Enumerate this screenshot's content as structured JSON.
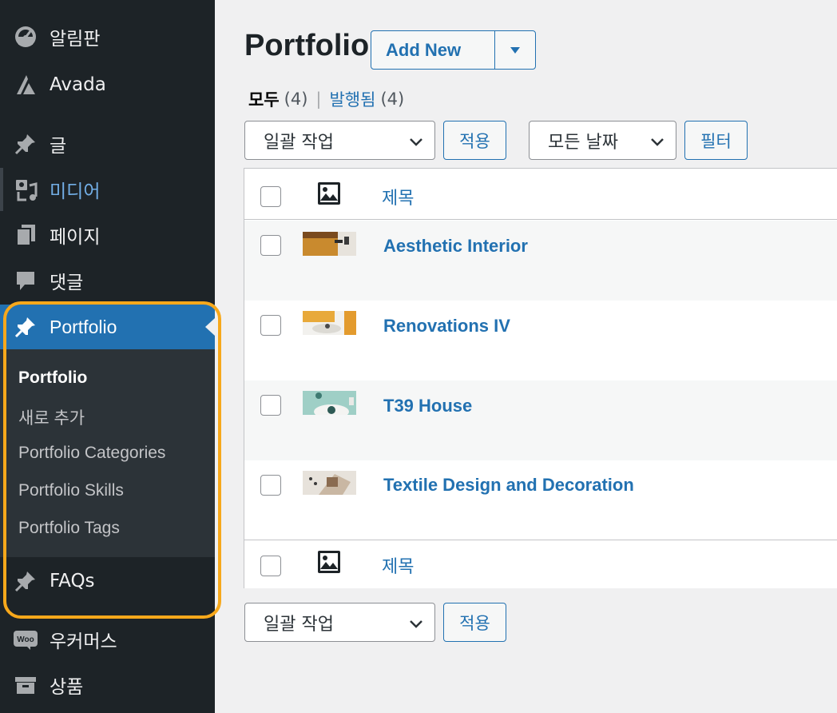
{
  "sidebar": {
    "items": [
      {
        "label": "알림판",
        "icon": "dashboard-icon"
      },
      {
        "label": "Avada",
        "icon": "avada-icon"
      },
      {
        "label": "글",
        "icon": "pin-icon"
      },
      {
        "label": "미디어",
        "icon": "media-icon"
      },
      {
        "label": "페이지",
        "icon": "pages-icon"
      },
      {
        "label": "댓글",
        "icon": "comments-icon"
      },
      {
        "label": "Portfolio",
        "icon": "pin-icon"
      },
      {
        "label": "FAQs",
        "icon": "pin-icon"
      },
      {
        "label": "우커머스",
        "icon": "woo-icon"
      },
      {
        "label": "상품",
        "icon": "archive-icon"
      }
    ],
    "submenu": [
      "Portfolio",
      "새로 추가",
      "Portfolio Categories",
      "Portfolio Skills",
      "Portfolio Tags"
    ],
    "woo_logo_text": "Woo"
  },
  "main": {
    "title": "Portfolio",
    "add_new": "Add New",
    "filters": {
      "all_label": "모두",
      "all_count": "(4)",
      "separator": "|",
      "published_label": "발행됨",
      "published_count": "(4)"
    },
    "bulk_action": "일괄 작업",
    "apply": "적용",
    "dates": "모든 날짜",
    "filter_btn": "필터",
    "column_title": "제목",
    "rows": [
      {
        "title": "Aesthetic Interior"
      },
      {
        "title": "Renovations IV"
      },
      {
        "title": "T39 House"
      },
      {
        "title": "Textile Design and Decoration"
      }
    ]
  },
  "colors": {
    "sidebar_bg": "#1d2327",
    "submenu_bg": "#2c3338",
    "active_blue": "#2271b1",
    "link_blue": "#72aee6",
    "highlight_orange": "#f7a81b"
  }
}
